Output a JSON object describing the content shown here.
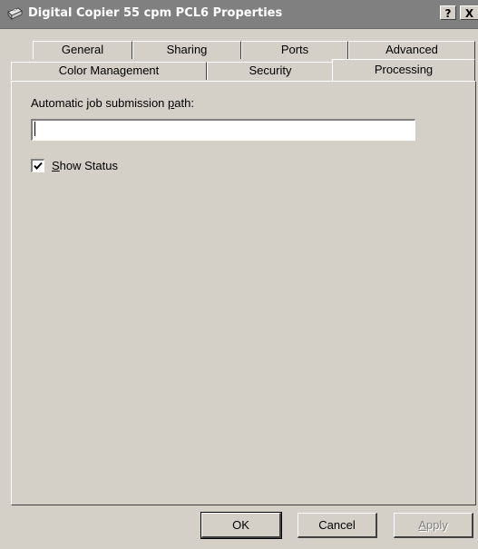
{
  "window": {
    "title": "Digital Copier 55 cpm PCL6 Properties",
    "help_label": "?",
    "close_label": "X"
  },
  "tabs_row1": [
    {
      "label": "General"
    },
    {
      "label": "Sharing"
    },
    {
      "label": "Ports"
    },
    {
      "label": "Advanced"
    }
  ],
  "tabs_row2": [
    {
      "label": "Color Management"
    },
    {
      "label": "Security"
    },
    {
      "label": "Processing",
      "selected": true
    }
  ],
  "processing": {
    "path_label": "Automatic job submission path:",
    "path_value": "",
    "show_status_label_prefix": "",
    "show_status_accel": "S",
    "show_status_label_rest": "how Status",
    "show_status_checked": true
  },
  "buttons": {
    "ok": "OK",
    "cancel": "Cancel",
    "apply": "Apply",
    "apply_enabled": false
  }
}
